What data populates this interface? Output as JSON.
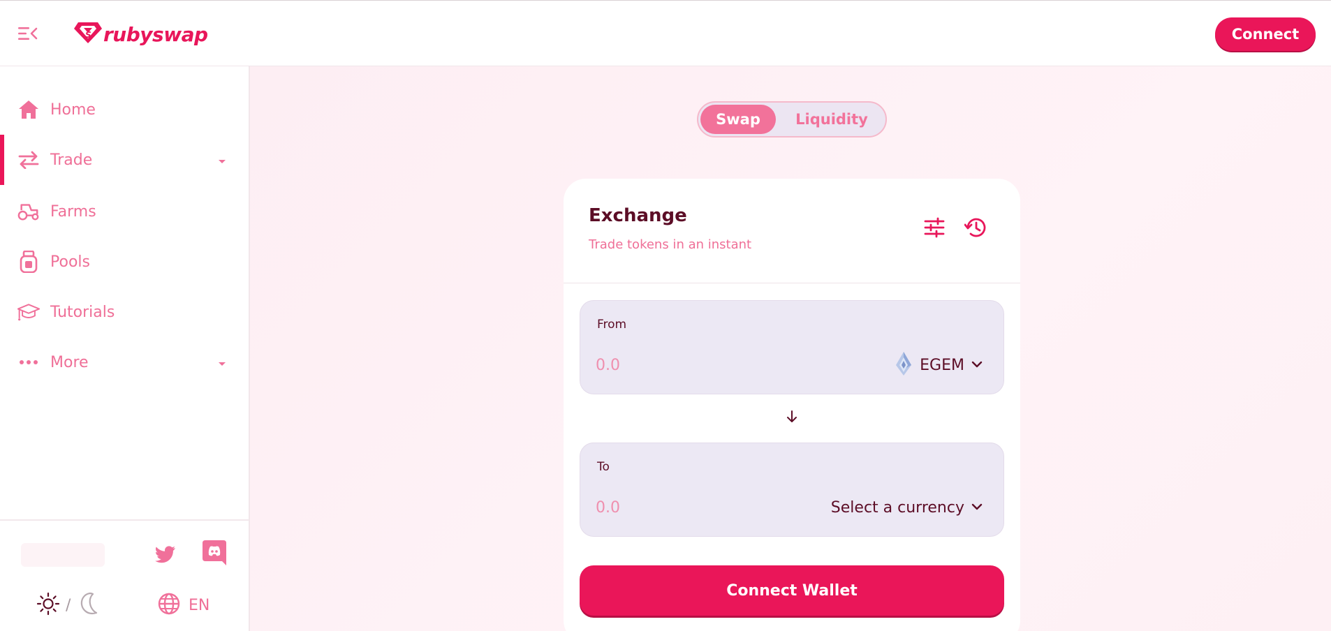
{
  "header": {
    "logo_text": "rubyswap",
    "connect_label": "Connect"
  },
  "sidebar": {
    "items": [
      {
        "label": "Home",
        "icon": "home-icon"
      },
      {
        "label": "Trade",
        "icon": "trade-arrows-icon",
        "expandable": true,
        "active": true
      },
      {
        "label": "Farms",
        "icon": "tractor-icon"
      },
      {
        "label": "Pools",
        "icon": "pool-jar-icon"
      },
      {
        "label": "Tutorials",
        "icon": "graduation-cap-icon"
      },
      {
        "label": "More",
        "icon": "more-dots-icon",
        "expandable": true
      }
    ],
    "social": [
      "twitter-icon",
      "discord-icon"
    ],
    "theme": {
      "light_icon": "sun-icon",
      "separator": "/",
      "dark_icon": "moon-icon"
    },
    "language": {
      "icon": "globe-icon",
      "label": "EN"
    }
  },
  "main": {
    "tabs": [
      {
        "label": "Swap",
        "active": true
      },
      {
        "label": "Liquidity",
        "active": false
      }
    ],
    "card": {
      "title": "Exchange",
      "subtitle": "Trade tokens in an instant",
      "icons": [
        "settings-sliders-icon",
        "history-icon"
      ],
      "from": {
        "label": "From",
        "placeholder": "0.0",
        "token": "EGEM",
        "token_icon": "egem-token-icon"
      },
      "to": {
        "label": "To",
        "placeholder": "0.0",
        "token": "Select a currency"
      },
      "connect_wallet_label": "Connect Wallet"
    }
  },
  "colors": {
    "brand": "#ea1659",
    "pink_text": "#ef6f97",
    "dark_text": "#5c0d26",
    "input_bg": "#ece8f4"
  }
}
